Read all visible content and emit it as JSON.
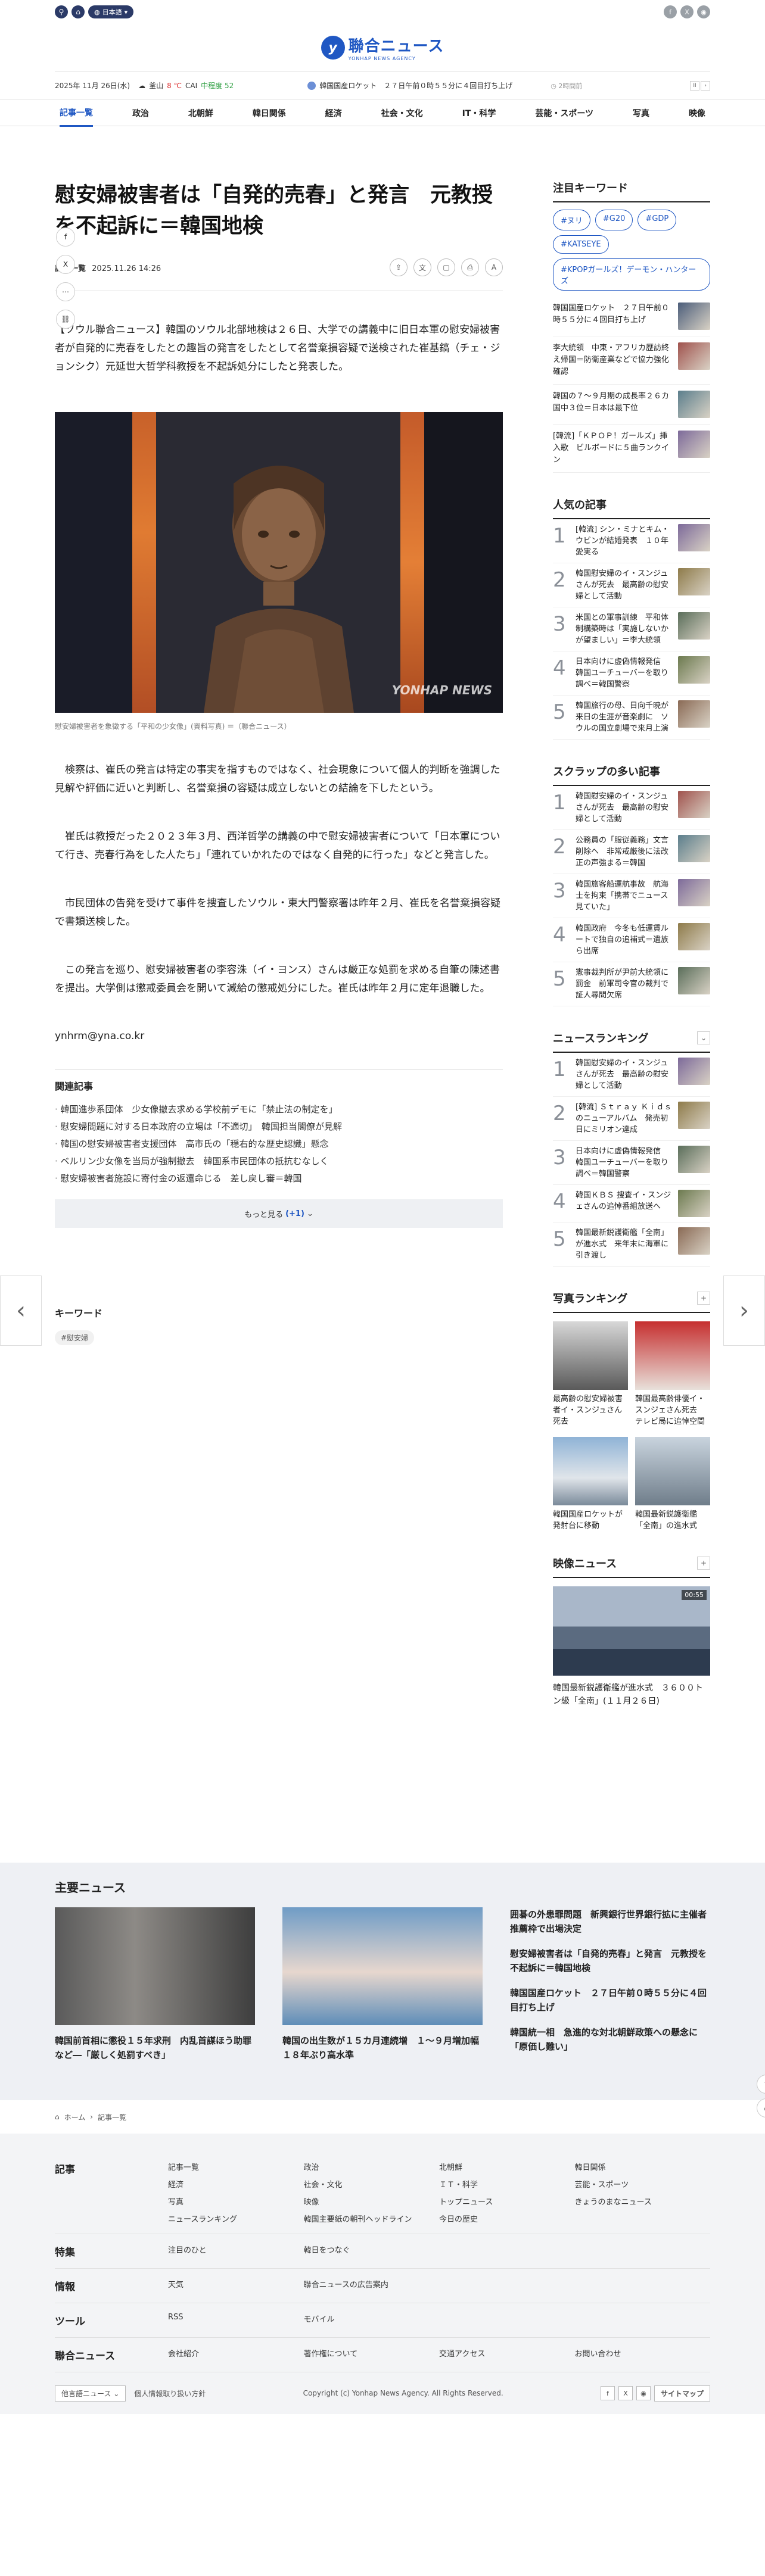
{
  "topbar": {
    "lang": "日本語",
    "icons": [
      "search-icon",
      "home-icon",
      "globe-icon"
    ],
    "sns": [
      "facebook-icon",
      "x-icon",
      "rss-icon"
    ]
  },
  "logo": {
    "main": "聯合ニュース",
    "sub": "YONHAP NEWS AGENCY"
  },
  "infobar": {
    "date": "2025年 11月 26日(水)",
    "city": "釜山",
    "temp": "8 ℃",
    "air_label": "CAI",
    "air_value": "中程度 52",
    "ticker": "韓国国産ロケット　２７日午前０時５５分に４回目打ち上げ",
    "ago": "2時間前"
  },
  "nav": [
    "記事一覧",
    "政治",
    "北朝鮮",
    "韓日関係",
    "経済",
    "社会・文化",
    "IT・科学",
    "芸能・スポーツ",
    "写真",
    "映像"
  ],
  "article": {
    "title": "慰安婦被害者は「自発的売春」と発言　元教授を不起訴に＝韓国地検",
    "category": "記事一覧",
    "datetime": "2025.11.26 14:26",
    "lead": "【ソウル聯合ニュース】韓国のソウル北部地検は２６日、大学での講義中に旧日本軍の慰安婦被害者が自発的に売春をしたとの趣旨の発言をしたとして名誉棄損容疑で送検された崔基鎬（チェ・ジョンシク）元延世大哲学科教授を不起訴処分にしたと発表した。",
    "watermark": "YONHAP NEWS",
    "caption": "慰安婦被害者を象徴する「平和の少女像」(資料写真) ＝（聯合ニュース）",
    "paras": [
      "検察は、崔氏の発言は特定の事実を指すものではなく、社会現象について個人的判断を強調した見解や評価に近いと判断し、名誉棄損の容疑は成立しないとの結論を下したという。",
      "崔氏は教授だった２０２３年３月、西洋哲学の講義の中で慰安婦被害者について「日本軍について行き、売春行為をした人たち」「連れていかれたのではなく自発的に行った」などと発言した。",
      "市民団体の告発を受けて事件を捜査したソウル・東大門警察署は昨年２月、崔氏を名誉棄損容疑で書類送検した。",
      "この発言を巡り、慰安婦被害者の李容洙（イ・ヨンス）さんは厳正な処罰を求める自筆の陳述書を提出。大学側は懲戒委員会を開いて減給の懲戒処分にした。崔氏は昨年２月に定年退職した。"
    ],
    "email": "ynhrm@yna.co.kr"
  },
  "related": {
    "heading": "関連記事",
    "items": [
      "韓国進歩系団体　少女像撤去求める学校前デモに「禁止法の制定を」",
      "慰安婦問題に対する日本政府の立場は「不適切」　韓国担当閣僚が見解",
      "韓国の慰安婦被害者支援団体　高市氏の「穏右的な歴史認識」懸念",
      "ベルリン少女像を当局が強制撤去　韓国系市民団体の抵抗むなしく",
      "慰安婦被害者施設に寄付金の返還命じる　差し戻し審＝韓国"
    ],
    "more_label": "もっと見る",
    "more_count": "(+1)"
  },
  "keywords_block": {
    "heading": "キーワード",
    "tag": "#慰安婦"
  },
  "sidebar": {
    "attention": {
      "heading": "注目キーワード",
      "chips": [
        "#ヌリ",
        "#G20",
        "#GDP",
        "#KATSEYE",
        "#KPOPガールズ！デーモン・ハンターズ"
      ],
      "items": [
        "韓国国産ロケット　２７日午前０時５５分に４回目打ち上げ",
        "李大統領　中東・アフリカ歴訪終え帰国＝防衛産業などで協力強化確認",
        "韓国の７～９月期の成長率２６カ国中３位＝日本は最下位",
        "[韓流]「ＫＰＯＰ！ガールズ」挿入歌　ビルボードに５曲ランクイン"
      ]
    },
    "popular": {
      "heading": "人気の記事",
      "items": [
        "[韓流] シン・ミナとキム・ウビンが結婚発表　１０年愛実る",
        "韓国慰安婦のイ・スンジュさんが死去　最高齢の慰安婦として活動",
        "米国との軍事訓練　平和体制構築時は「実施しないかが望ましい」＝李大統領",
        "日本向けに虚偽情報発信　韓国ユーチューバーを取り調べ＝韓国警察",
        "韓国旅行の母、日向千暁が来日の生涯が音楽劇に　ソウルの国立劇場で来月上演"
      ]
    },
    "scoop": {
      "heading": "スクラップの多い記事",
      "items": [
        "韓国慰安婦のイ・スンジュさんが死去　最高齢の慰安婦として活動",
        "公務員の「服従義務」文言削除へ　非常戒厳後に法改正の声強まる＝韓国",
        "韓国旅客船運航事故　航海士を拘束「携帯でニュース見ていた」",
        "韓国政府　今冬も低運賃ルートで独自の追補式＝遺族ら出席",
        "憲事裁判所が尹前大統領に罰金　前軍司令官の裁判で証人尋問欠席"
      ]
    },
    "ranking": {
      "heading": "ニュースランキング",
      "items": [
        "韓国慰安婦のイ・スンジュさんが死去　最高齢の慰安婦として活動",
        "[韓流] Ｓｔｒａｙ Ｋｉｄｓのニューアルバム　発売初日にミリオン達成",
        "日本向けに虚偽情報発信　韓国ユーチューバーを取り調べ＝韓国警察",
        "韓国ＫＢＳ 捜査イ・スンジェさんの追悼番組放送へ",
        "韓国最新鋭護衛艦「全南」が進水式　来年末に海軍に引き渡し"
      ]
    },
    "photo_ranking": {
      "heading": "写真ランキング",
      "items": [
        "最高齢の慰安婦被害者イ・スンジュさん死去",
        "韓国最高齢俳優イ・スンジェさん死去　テレビ局に追悼空間",
        "韓国国産ロケットが発射台に移動",
        "韓国最新鋭護衛艦「全南」の進水式"
      ]
    },
    "video": {
      "heading": "映像ニュース",
      "duration": "00:55",
      "title": "韓国最新鋭護衛艦が進水式　３６００トン級「全南」(１１月２６日)"
    }
  },
  "main_news": {
    "heading": "主要ニュース",
    "cards": [
      "韓国前首相に懲役１５年求刑　内乱首謀ほう助罪など―「厳しく処罰すべき」",
      "韓国の出生数が１５カ月連続増　１～９月増加幅１８年ぶり高水準"
    ],
    "list": [
      "囲碁の外患罪問題　新興銀行世界銀行拡に主催者推薦枠で出場決定",
      "慰安婦被害者は「自発的売春」と発言　元教授を不起訴に＝韓国地検",
      "韓国国産ロケット　２７日午前０時５５分に４回目打ち上げ",
      "韓国統一相　急進的な対北朝鮮政策への懸念に「原価し難い」"
    ]
  },
  "breadcrumb": {
    "home": "ホーム",
    "current": "記事一覧"
  },
  "footer": {
    "rows": [
      {
        "head": "記事",
        "links": [
          "記事一覧",
          "政治",
          "北朝鮮",
          "韓日関係",
          "経済",
          "社会・文化",
          "ＩＴ・科学",
          "芸能・スポーツ",
          "写真",
          "映像",
          "トップニュース",
          "きょうのまなニュース",
          "ニュースランキング",
          "韓国主要紙の朝刊ヘッドライン",
          "今日の歴史",
          ""
        ]
      },
      {
        "head": "特集",
        "links": [
          "注目のひと",
          "韓日をつなぐ",
          "",
          ""
        ]
      },
      {
        "head": "情報",
        "links": [
          "天気",
          "聯合ニュースの広告案内",
          "",
          ""
        ]
      },
      {
        "head": "ツール",
        "links": [
          "RSS",
          "モバイル",
          "",
          ""
        ]
      },
      {
        "head": "聯合ニュース",
        "links": [
          "会社紹介",
          "著作権について",
          "交通アクセス",
          "お問い合わせ"
        ]
      }
    ],
    "select": "他言語ニュース",
    "privacy": "個人情報取り扱い方針",
    "copyright": "Copyright (c) Yonhap News Agency. All Rights Reserved.",
    "sitemap": "サイトマップ"
  }
}
